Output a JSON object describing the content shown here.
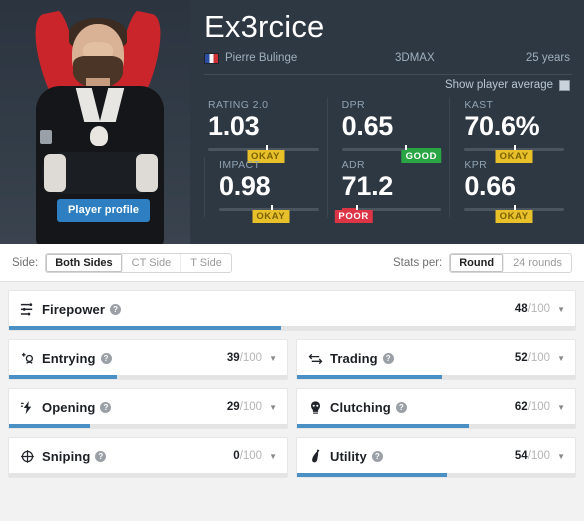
{
  "player": {
    "nickname": "Ex3rcice",
    "real_name": "Pierre Bulinge",
    "country_flag": "france-flag-icon",
    "team": "3DMAX",
    "age": "25 years",
    "profile_button": "Player profile",
    "show_average_label": "Show player average"
  },
  "stats": [
    {
      "label": "RATING 2.0",
      "value": "1.03",
      "badge": "OKAY",
      "badge_kind": "okay",
      "marker_pct": 52
    },
    {
      "label": "DPR",
      "value": "0.65",
      "badge": "GOOD",
      "badge_kind": "good",
      "marker_pct": 64
    },
    {
      "label": "KAST",
      "value": "70.6%",
      "badge": "OKAY",
      "badge_kind": "okay",
      "marker_pct": 50
    },
    {
      "label": "IMPACT",
      "value": "0.98",
      "badge": "OKAY",
      "badge_kind": "okay",
      "marker_pct": 52
    },
    {
      "label": "ADR",
      "value": "71.2",
      "badge": "POOR",
      "badge_kind": "poor",
      "marker_pct": 14
    },
    {
      "label": "KPR",
      "value": "0.66",
      "badge": "OKAY",
      "badge_kind": "okay",
      "marker_pct": 50
    }
  ],
  "filters": {
    "side_label": "Side:",
    "side_options": [
      "Both Sides",
      "CT Side",
      "T Side"
    ],
    "side_selected": "Both Sides",
    "stats_per_label": "Stats per:",
    "stats_per_options": [
      "Round",
      "24 rounds"
    ],
    "stats_per_selected": "Round"
  },
  "skills": {
    "firepower": {
      "name": "Firepower",
      "score": "48",
      "denominator": "/100",
      "pct": 48,
      "icon": "firepower-icon"
    },
    "entrying": {
      "name": "Entrying",
      "score": "39",
      "denominator": "/100",
      "pct": 39,
      "icon": "entrying-icon"
    },
    "trading": {
      "name": "Trading",
      "score": "52",
      "denominator": "/100",
      "pct": 52,
      "icon": "trading-icon"
    },
    "opening": {
      "name": "Opening",
      "score": "29",
      "denominator": "/100",
      "pct": 29,
      "icon": "opening-icon"
    },
    "clutching": {
      "name": "Clutching",
      "score": "62",
      "denominator": "/100",
      "pct": 62,
      "icon": "clutching-icon"
    },
    "sniping": {
      "name": "Sniping",
      "score": "0",
      "denominator": "/100",
      "pct": 0,
      "icon": "sniping-icon"
    },
    "utility": {
      "name": "Utility",
      "score": "54",
      "denominator": "/100",
      "pct": 54,
      "icon": "utility-icon"
    }
  },
  "icons": {
    "help": "?",
    "caret_down": "▼"
  },
  "colors": {
    "hero_bg": "#2e3843",
    "accent_blue": "#4a90c4",
    "button_blue": "#2d7fc1",
    "okay": "#e8c02a",
    "good": "#2aa544",
    "poor": "#dc3545",
    "logo_red": "#c9252b"
  }
}
